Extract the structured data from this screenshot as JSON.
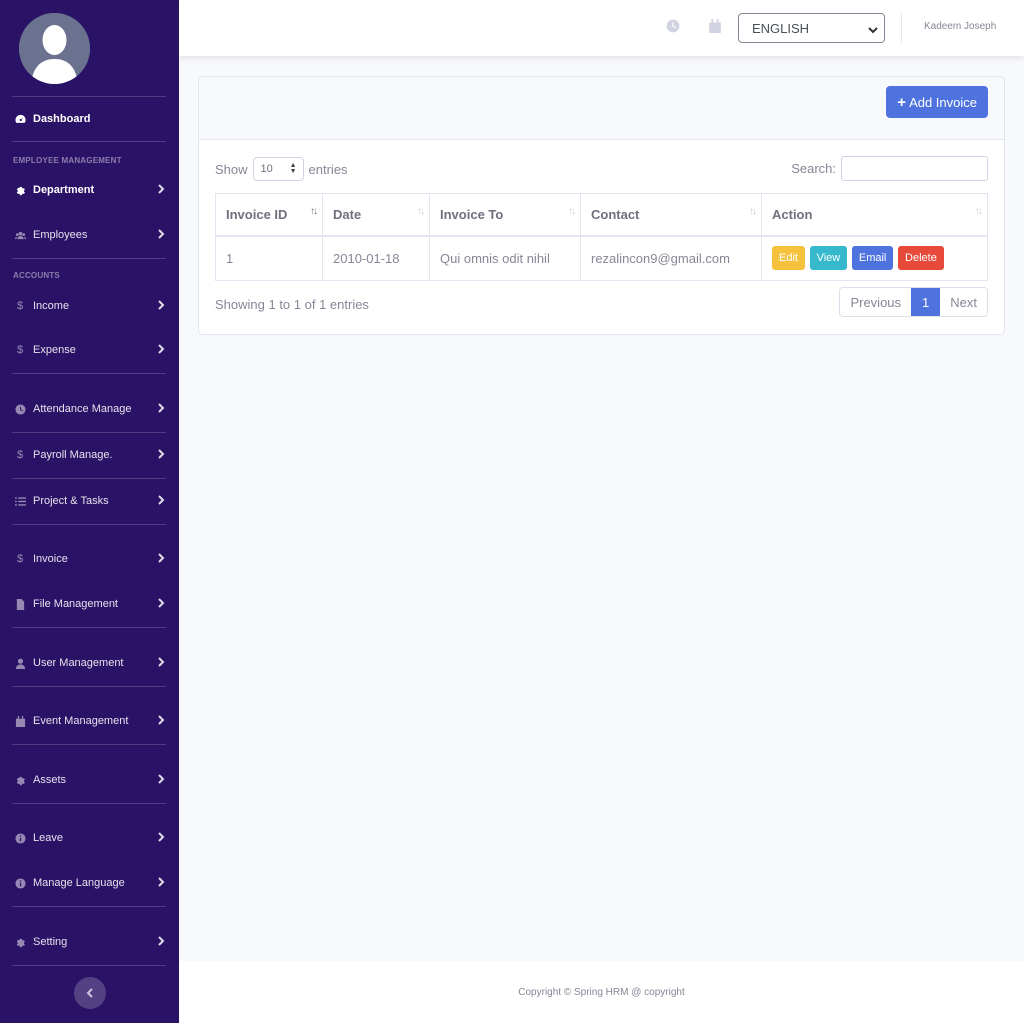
{
  "sidebar": {
    "dashboard": "Dashboard",
    "section_employee": "EMPLOYEE MANAGEMENT",
    "department": "Department",
    "employees": "Employees",
    "section_accounts": "ACCOUNTS",
    "income": "Income",
    "expense": "Expense",
    "attendance": "Attendance Manage",
    "payroll": "Payroll Manage.",
    "project": "Project & Tasks",
    "invoice": "Invoice",
    "file": "File Management",
    "user": "User Management",
    "event": "Event Management",
    "assets": "Assets",
    "leave": "Leave",
    "language": "Manage Language",
    "setting": "Setting"
  },
  "topbar": {
    "language": "ENGLISH",
    "username": "Kadeem Joseph"
  },
  "card": {
    "add_button": "Add Invoice",
    "show_label": "Show",
    "entries_label": "entries",
    "page_length": "10",
    "search_label": "Search:",
    "search_value": "",
    "columns": [
      "Invoice ID",
      "Date",
      "Invoice To",
      "Contact",
      "Action"
    ],
    "rows": [
      {
        "id": "1",
        "date": "2010-01-18",
        "to": "Qui omnis odit nihil",
        "contact": "rezalincon9@gmail.com"
      }
    ],
    "actions": {
      "edit": "Edit",
      "view": "View",
      "email": "Email",
      "delete": "Delete"
    },
    "info": "Showing 1 to 1 of 1 entries",
    "pager": {
      "prev": "Previous",
      "current": "1",
      "next": "Next"
    }
  },
  "footer": "Copyright © Spring HRM @ copyright",
  "colors": {
    "sidebar_bg": "#2a1266",
    "primary": "#4e73df",
    "edit": "#f6c23e",
    "view": "#36b9cc",
    "delete": "#e74a3b"
  },
  "icons": {
    "dashboard": "tachometer-icon",
    "department": "cog-icon",
    "employees": "users-icon",
    "income": "dollar-icon",
    "expense": "dollar-icon",
    "attendance": "clock-icon",
    "payroll": "dollar-icon",
    "project": "tasks-icon",
    "invoice": "dollar-icon",
    "file": "file-icon",
    "user": "user-icon",
    "event": "calendar-icon",
    "assets": "cog-icon",
    "leave": "info-icon",
    "language": "info-icon",
    "setting": "cog-icon"
  }
}
